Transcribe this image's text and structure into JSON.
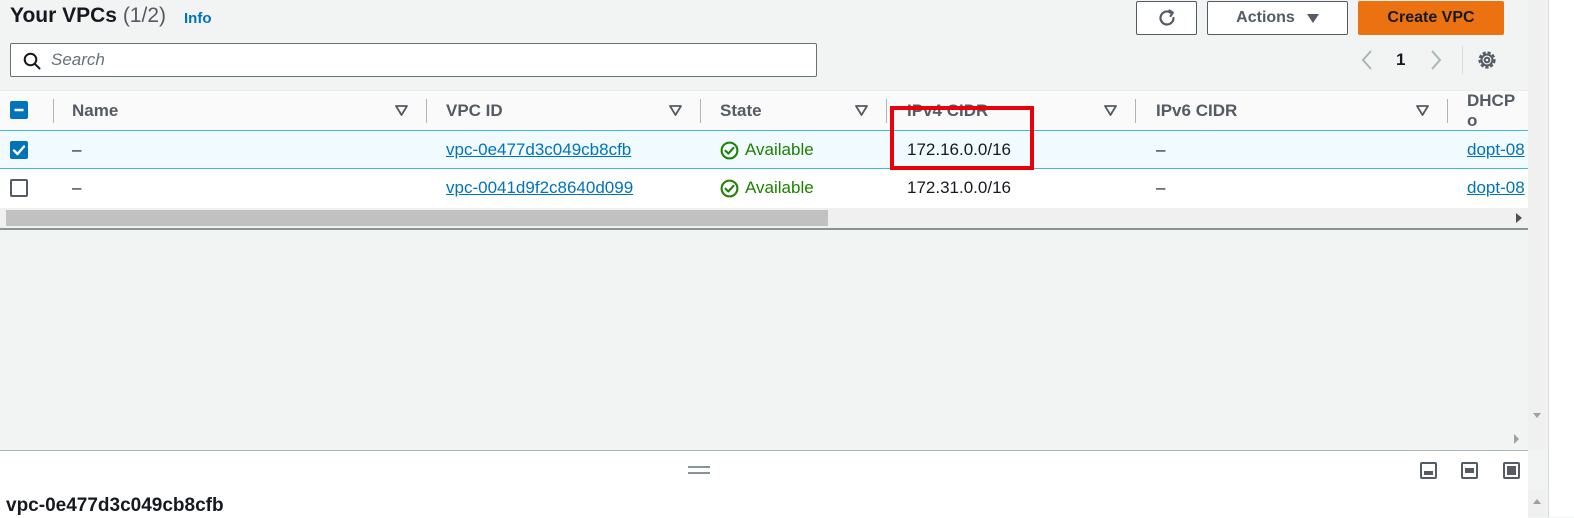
{
  "header": {
    "title": "Your VPCs",
    "count": "(1/2)",
    "info_label": "Info",
    "actions_label": "Actions",
    "create_label": "Create VPC"
  },
  "search": {
    "placeholder": "Search"
  },
  "pagination": {
    "current_page": "1"
  },
  "table": {
    "columns": [
      "Name",
      "VPC ID",
      "State",
      "IPv4 CIDR",
      "IPv6 CIDR",
      "DHCP o"
    ],
    "rows": [
      {
        "selected": true,
        "name": "–",
        "vpc_id": "vpc-0e477d3c049cb8cfb",
        "state": "Available",
        "ipv4": "172.16.0.0/16",
        "ipv6": "–",
        "dhcp": "dopt-08"
      },
      {
        "selected": false,
        "name": "–",
        "vpc_id": "vpc-0041d9f2c8640d099",
        "state": "Available",
        "ipv4": "172.31.0.0/16",
        "ipv6": "–",
        "dhcp": "dopt-08"
      }
    ]
  },
  "split_panel": {
    "title": "vpc-0e477d3c049cb8cfb"
  },
  "colors": {
    "primary": "#ec7211",
    "link": "#0073bb",
    "success": "#1d8102",
    "highlight_box": "#e8000b"
  },
  "icons": [
    "search-icon",
    "refresh-icon",
    "caret-down-icon",
    "chevron-left-icon",
    "chevron-right-icon",
    "settings-icon",
    "sort-icon",
    "status-available-icon",
    "drag-handle-icon",
    "panel-bottom-icon",
    "panel-side-icon",
    "panel-full-icon"
  ]
}
